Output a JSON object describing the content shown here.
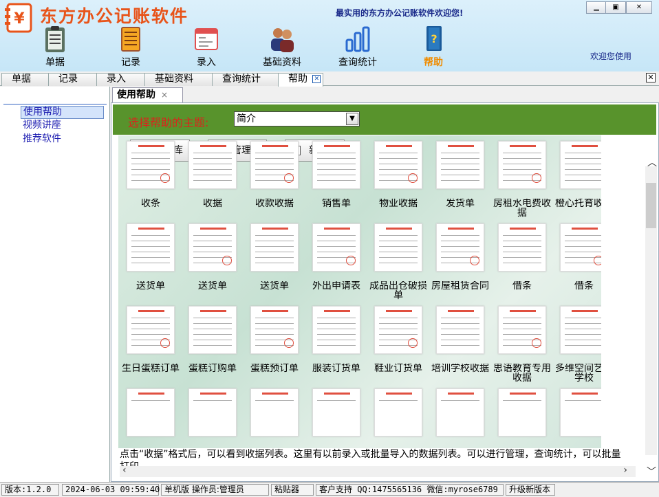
{
  "app": {
    "title": "东方办公记账软件",
    "slogan": "最实用的东方办公记账软件欢迎您!",
    "welcome": "欢迎您使用",
    "window_controls": [
      "minimize",
      "restore",
      "close"
    ]
  },
  "toolbar": [
    {
      "label": "单据",
      "icon": "clipboard-icon"
    },
    {
      "label": "记录",
      "icon": "notebook-icon"
    },
    {
      "label": "录入",
      "icon": "form-window-icon"
    },
    {
      "label": "基础资料",
      "icon": "people-icon"
    },
    {
      "label": "查询统计",
      "icon": "bar-chart-icon"
    },
    {
      "label": "帮助",
      "icon": "help-book-icon",
      "active": true
    }
  ],
  "main_tabs": [
    "单据",
    "记录",
    "录入",
    "基础资料",
    "查询统计",
    "帮助"
  ],
  "sidebar": {
    "items": [
      "使用帮助",
      "视频讲座",
      "推荐软件"
    ]
  },
  "subtab": {
    "label": "使用帮助",
    "close": "×"
  },
  "help": {
    "topic_label": "选择帮助的主题:",
    "topic_value": "简介",
    "buttons": [
      "模板库",
      "管理",
      "新建"
    ],
    "templates": [
      [
        "收条",
        "收据",
        "收款收据",
        "销售单",
        "物业收据",
        "发货单",
        "房租水电费收据",
        "橙心托育收据"
      ],
      [
        "送货单",
        "送货单",
        "送货单",
        "外出申请表",
        "成品出仓破损单",
        "房屋租赁合同",
        "借条",
        "借条"
      ],
      [
        "生日蛋糕订单",
        "蛋糕订购单",
        "蛋糕预订单",
        "服装订货单",
        "鞋业订货单",
        "培训学校收据",
        "思语教育专用收据",
        "多维空间艺术学校"
      ]
    ],
    "description": "点击“收据”格式后，可以看到收据列表。这里有以前录入或批量导入的数据列表。可以进行管理，查询统计，可以批量打印。"
  },
  "status_bar": {
    "version": "版本:1.2.0",
    "datetime": "2024-06-03 09:59:40",
    "mode": "单机版 操作员:管理员",
    "clipboard": "粘贴器",
    "support": "客户支持 QQ:1475565136 微信:myrose6789",
    "upgrade": "升级新版本"
  },
  "colors": {
    "title": "#e8541a",
    "green_bar": "#58932c",
    "topic_label": "#d9241c",
    "active_tool": "#f08c00",
    "nav_link": "#1a1ab0"
  }
}
